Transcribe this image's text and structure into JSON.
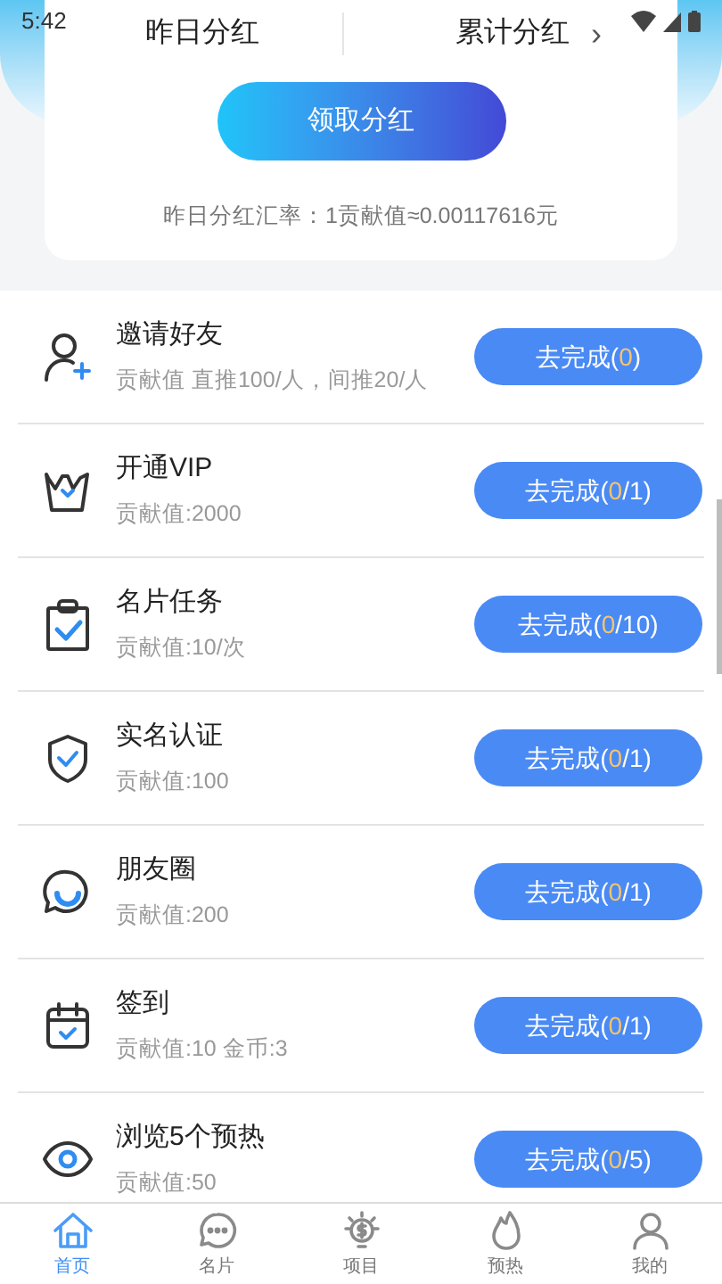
{
  "status_bar": {
    "time": "5:42"
  },
  "summary": {
    "left_label": "昨日分红",
    "right_label": "累计分红",
    "right_arrow": "›",
    "claim_button": "领取分红",
    "rate_text": "昨日分红汇率：1贡献值≈0.00117616元"
  },
  "tasks": [
    {
      "kind": "person-add",
      "title": "邀请好友",
      "reward": "贡献值 直推100/人，间推20/人",
      "button": {
        "label": "去完成(",
        "done": "0",
        "rest": ")"
      }
    },
    {
      "kind": "crown",
      "title": "开通VIP",
      "reward": "贡献值:2000",
      "button": {
        "label": "去完成(",
        "done": "0",
        "rest": "/1)"
      }
    },
    {
      "kind": "clipboard",
      "title": "名片任务",
      "reward": "贡献值:10/次",
      "button": {
        "label": "去完成(",
        "done": "0",
        "rest": "/10)"
      }
    },
    {
      "kind": "shield",
      "title": "实名认证",
      "reward": "贡献值:100",
      "button": {
        "label": "去完成(",
        "done": "0",
        "rest": "/1)"
      }
    },
    {
      "kind": "chat",
      "title": "朋友圈",
      "reward": "贡献值:200",
      "button": {
        "label": "去完成(",
        "done": "0",
        "rest": "/1)"
      }
    },
    {
      "kind": "calendar",
      "title": "签到",
      "reward": "贡献值:10 金币:3",
      "button": {
        "label": "去完成(",
        "done": "0",
        "rest": "/1)"
      }
    },
    {
      "kind": "eye",
      "title": "浏览5个预热",
      "reward": "贡献值:50",
      "button": {
        "label": "去完成(",
        "done": "0",
        "rest": "/5)"
      }
    }
  ],
  "tab_bar": [
    {
      "kind": "home",
      "label": "首页",
      "selected": true
    },
    {
      "kind": "chat",
      "label": "名片",
      "selected": false
    },
    {
      "kind": "bulb",
      "label": "项目",
      "selected": false
    },
    {
      "kind": "flame",
      "label": "预热",
      "selected": false
    },
    {
      "kind": "person",
      "label": "我的",
      "selected": false
    }
  ]
}
